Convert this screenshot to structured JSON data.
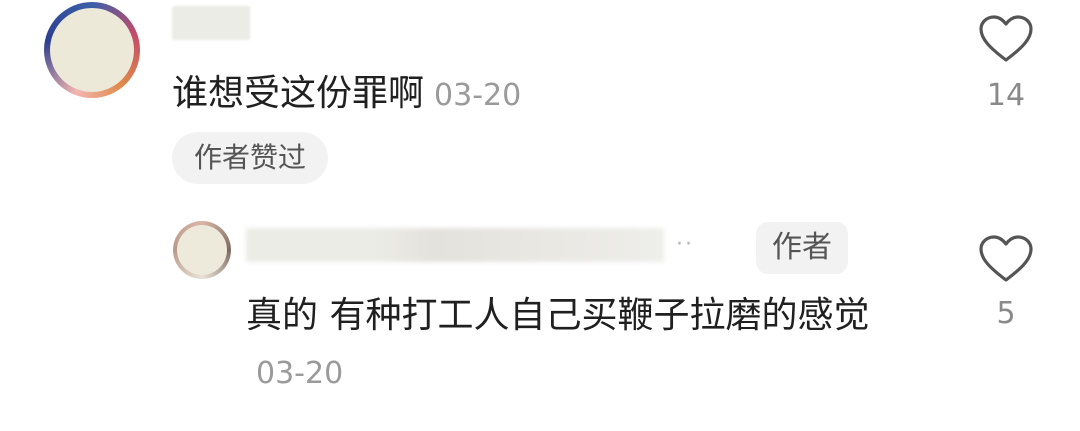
{
  "comments": [
    {
      "text": "谁想受这份罪啊",
      "date": "03-20",
      "badge": "作者赞过",
      "likes": "14"
    }
  ],
  "reply": {
    "author_badge": "作者",
    "name_ellipsis": "··",
    "text": "真的 有种打工人自己买鞭子拉磨的感觉",
    "date": "03-20",
    "likes": "5"
  },
  "icons": {
    "like": "heart-outline-icon"
  }
}
